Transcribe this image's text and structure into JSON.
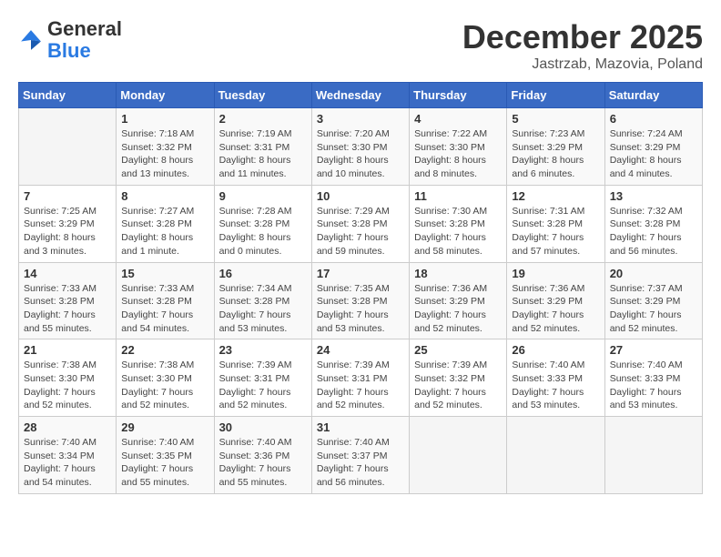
{
  "logo": {
    "general": "General",
    "blue": "Blue"
  },
  "header": {
    "month": "December 2025",
    "location": "Jastrzab, Mazovia, Poland"
  },
  "weekdays": [
    "Sunday",
    "Monday",
    "Tuesday",
    "Wednesday",
    "Thursday",
    "Friday",
    "Saturday"
  ],
  "weeks": [
    [
      {
        "day": "",
        "info": ""
      },
      {
        "day": "1",
        "info": "Sunrise: 7:18 AM\nSunset: 3:32 PM\nDaylight: 8 hours\nand 13 minutes."
      },
      {
        "day": "2",
        "info": "Sunrise: 7:19 AM\nSunset: 3:31 PM\nDaylight: 8 hours\nand 11 minutes."
      },
      {
        "day": "3",
        "info": "Sunrise: 7:20 AM\nSunset: 3:30 PM\nDaylight: 8 hours\nand 10 minutes."
      },
      {
        "day": "4",
        "info": "Sunrise: 7:22 AM\nSunset: 3:30 PM\nDaylight: 8 hours\nand 8 minutes."
      },
      {
        "day": "5",
        "info": "Sunrise: 7:23 AM\nSunset: 3:29 PM\nDaylight: 8 hours\nand 6 minutes."
      },
      {
        "day": "6",
        "info": "Sunrise: 7:24 AM\nSunset: 3:29 PM\nDaylight: 8 hours\nand 4 minutes."
      }
    ],
    [
      {
        "day": "7",
        "info": "Sunrise: 7:25 AM\nSunset: 3:29 PM\nDaylight: 8 hours\nand 3 minutes."
      },
      {
        "day": "8",
        "info": "Sunrise: 7:27 AM\nSunset: 3:28 PM\nDaylight: 8 hours\nand 1 minute."
      },
      {
        "day": "9",
        "info": "Sunrise: 7:28 AM\nSunset: 3:28 PM\nDaylight: 8 hours\nand 0 minutes."
      },
      {
        "day": "10",
        "info": "Sunrise: 7:29 AM\nSunset: 3:28 PM\nDaylight: 7 hours\nand 59 minutes."
      },
      {
        "day": "11",
        "info": "Sunrise: 7:30 AM\nSunset: 3:28 PM\nDaylight: 7 hours\nand 58 minutes."
      },
      {
        "day": "12",
        "info": "Sunrise: 7:31 AM\nSunset: 3:28 PM\nDaylight: 7 hours\nand 57 minutes."
      },
      {
        "day": "13",
        "info": "Sunrise: 7:32 AM\nSunset: 3:28 PM\nDaylight: 7 hours\nand 56 minutes."
      }
    ],
    [
      {
        "day": "14",
        "info": "Sunrise: 7:33 AM\nSunset: 3:28 PM\nDaylight: 7 hours\nand 55 minutes."
      },
      {
        "day": "15",
        "info": "Sunrise: 7:33 AM\nSunset: 3:28 PM\nDaylight: 7 hours\nand 54 minutes."
      },
      {
        "day": "16",
        "info": "Sunrise: 7:34 AM\nSunset: 3:28 PM\nDaylight: 7 hours\nand 53 minutes."
      },
      {
        "day": "17",
        "info": "Sunrise: 7:35 AM\nSunset: 3:28 PM\nDaylight: 7 hours\nand 53 minutes."
      },
      {
        "day": "18",
        "info": "Sunrise: 7:36 AM\nSunset: 3:29 PM\nDaylight: 7 hours\nand 52 minutes."
      },
      {
        "day": "19",
        "info": "Sunrise: 7:36 AM\nSunset: 3:29 PM\nDaylight: 7 hours\nand 52 minutes."
      },
      {
        "day": "20",
        "info": "Sunrise: 7:37 AM\nSunset: 3:29 PM\nDaylight: 7 hours\nand 52 minutes."
      }
    ],
    [
      {
        "day": "21",
        "info": "Sunrise: 7:38 AM\nSunset: 3:30 PM\nDaylight: 7 hours\nand 52 minutes."
      },
      {
        "day": "22",
        "info": "Sunrise: 7:38 AM\nSunset: 3:30 PM\nDaylight: 7 hours\nand 52 minutes."
      },
      {
        "day": "23",
        "info": "Sunrise: 7:39 AM\nSunset: 3:31 PM\nDaylight: 7 hours\nand 52 minutes."
      },
      {
        "day": "24",
        "info": "Sunrise: 7:39 AM\nSunset: 3:31 PM\nDaylight: 7 hours\nand 52 minutes."
      },
      {
        "day": "25",
        "info": "Sunrise: 7:39 AM\nSunset: 3:32 PM\nDaylight: 7 hours\nand 52 minutes."
      },
      {
        "day": "26",
        "info": "Sunrise: 7:40 AM\nSunset: 3:33 PM\nDaylight: 7 hours\nand 53 minutes."
      },
      {
        "day": "27",
        "info": "Sunrise: 7:40 AM\nSunset: 3:33 PM\nDaylight: 7 hours\nand 53 minutes."
      }
    ],
    [
      {
        "day": "28",
        "info": "Sunrise: 7:40 AM\nSunset: 3:34 PM\nDaylight: 7 hours\nand 54 minutes."
      },
      {
        "day": "29",
        "info": "Sunrise: 7:40 AM\nSunset: 3:35 PM\nDaylight: 7 hours\nand 55 minutes."
      },
      {
        "day": "30",
        "info": "Sunrise: 7:40 AM\nSunset: 3:36 PM\nDaylight: 7 hours\nand 55 minutes."
      },
      {
        "day": "31",
        "info": "Sunrise: 7:40 AM\nSunset: 3:37 PM\nDaylight: 7 hours\nand 56 minutes."
      },
      {
        "day": "",
        "info": ""
      },
      {
        "day": "",
        "info": ""
      },
      {
        "day": "",
        "info": ""
      }
    ]
  ]
}
